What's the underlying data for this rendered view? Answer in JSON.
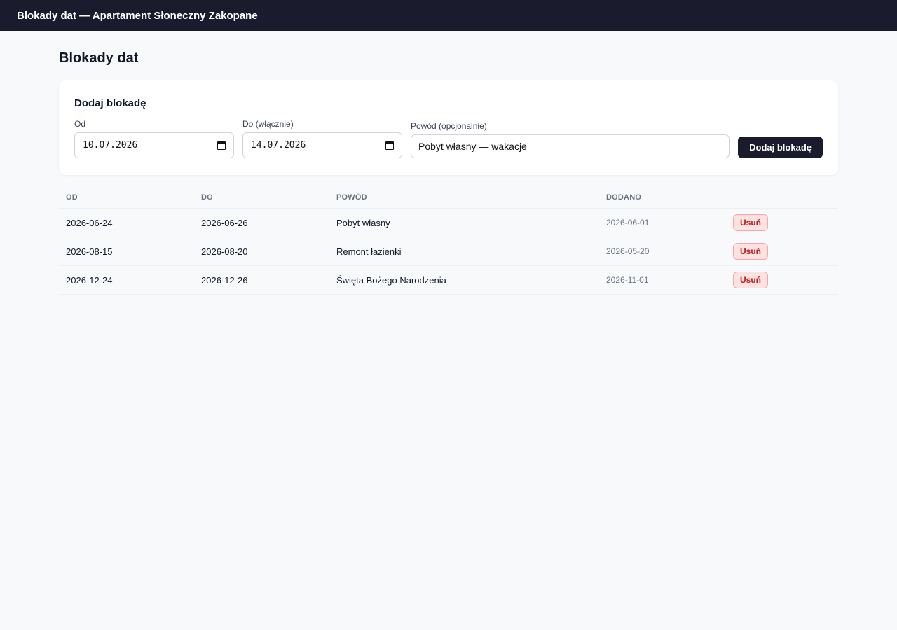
{
  "header": {
    "title": "Blokady dat — Apartament Słoneczny Zakopane"
  },
  "page": {
    "title": "Blokady dat"
  },
  "form": {
    "title": "Dodaj blokadę",
    "from_label": "Od",
    "from_value": "10.07.2026",
    "to_label": "Do (włącznie)",
    "to_value": "14.07.2026",
    "reason_label": "Powód (opcjonalnie)",
    "reason_value": "Pobyt własny — wakacje",
    "submit_label": "Dodaj blokadę"
  },
  "table": {
    "columns": [
      "OD",
      "DO",
      "POWÓD",
      "DODANO",
      ""
    ],
    "rows": [
      {
        "from": "2026-06-24",
        "to": "2026-06-26",
        "reason": "Pobyt własny",
        "added": "2026-06-01",
        "action": "Usuń"
      },
      {
        "from": "2026-08-15",
        "to": "2026-08-20",
        "reason": "Remont łazienki",
        "added": "2026-05-20",
        "action": "Usuń"
      },
      {
        "from": "2026-12-24",
        "to": "2026-12-26",
        "reason": "Święta Bożego Narodzenia",
        "added": "2026-11-01",
        "action": "Usuń"
      }
    ]
  },
  "icons": {
    "date_picker": "calendar-icon"
  },
  "colors": {
    "topbar": "#1b1b2e",
    "delete_bg": "#fde2e2",
    "delete_text": "#b91c1c",
    "background": "#f7f9fb"
  }
}
